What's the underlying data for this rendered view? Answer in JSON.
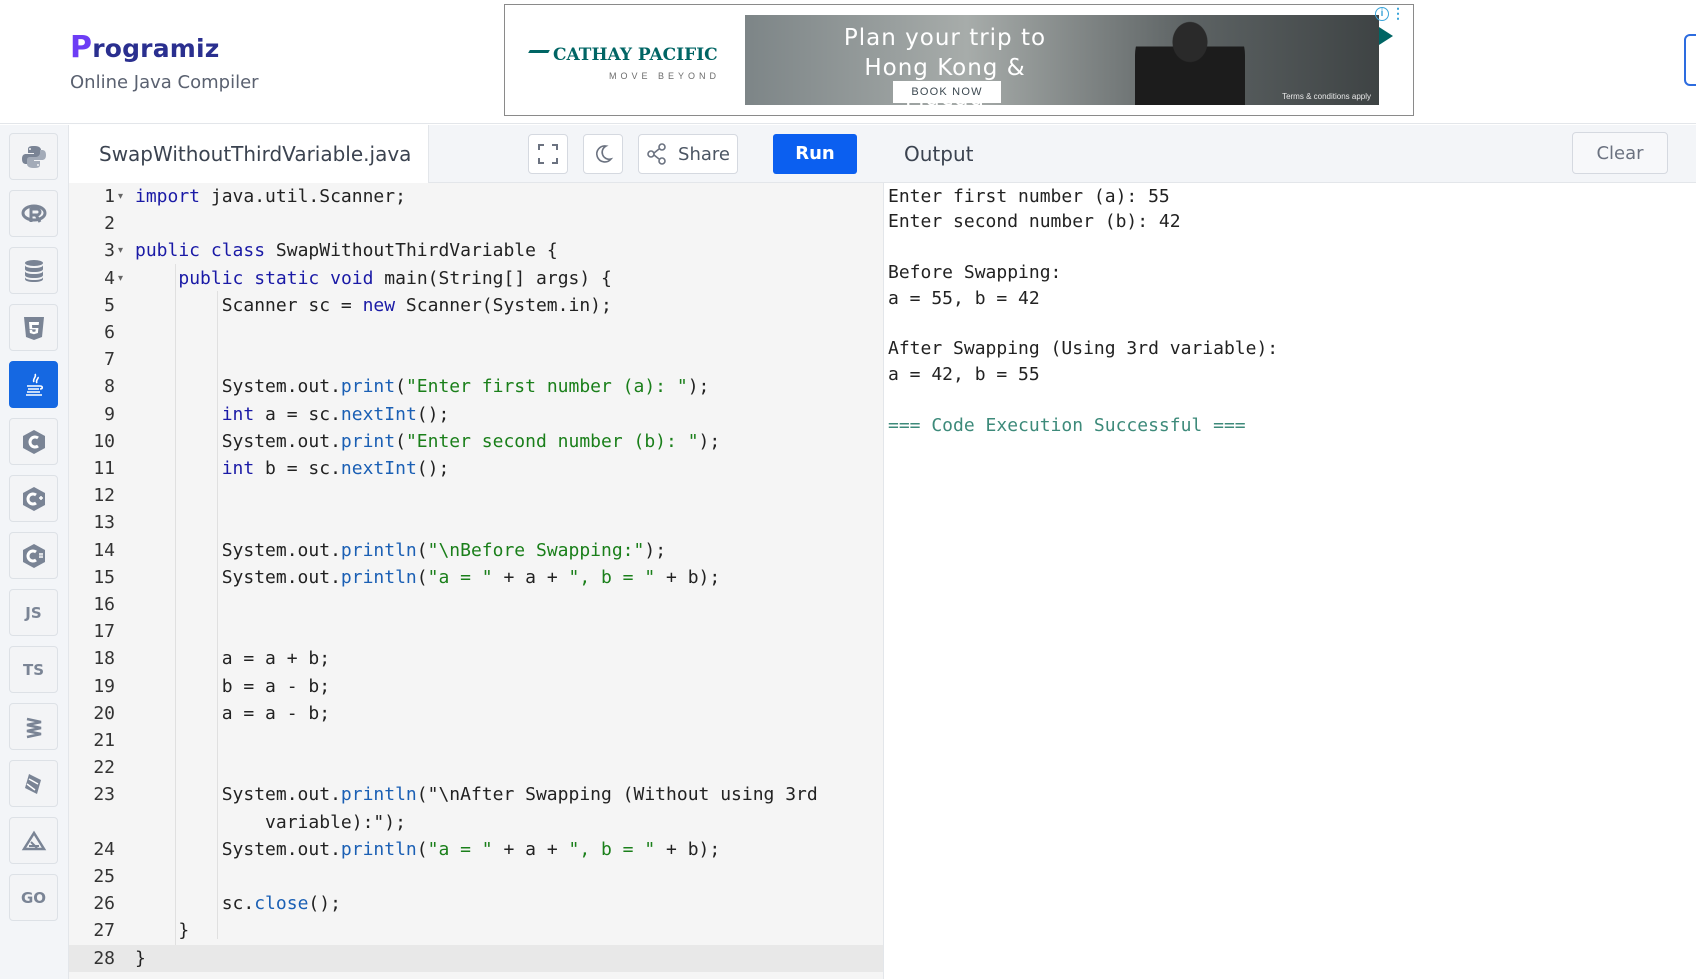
{
  "brand": {
    "logo_initial": "P",
    "logo_rest": "rogramiz",
    "subtitle": "Online Java Compiler"
  },
  "ad": {
    "brand": "CATHAY PACIFIC",
    "tagline": "MOVE BEYOND",
    "headline": "Plan your trip to Hong Kong & Macau",
    "cta": "BOOK NOW",
    "terms": "Terms & conditions apply",
    "info_icon": "info-icon",
    "colors": {
      "brand": "#006564",
      "info": "#3ba4d9"
    }
  },
  "sidebar": {
    "items": [
      {
        "name": "python",
        "icon": "python-icon",
        "label": ""
      },
      {
        "name": "r",
        "icon": "r-icon",
        "label": ""
      },
      {
        "name": "sql",
        "icon": "database-icon",
        "label": ""
      },
      {
        "name": "html",
        "icon": "html5-icon",
        "label": ""
      },
      {
        "name": "java",
        "icon": "java-icon",
        "label": "",
        "active": true
      },
      {
        "name": "c",
        "icon": "c-icon",
        "label": ""
      },
      {
        "name": "cpp",
        "icon": "cpp-icon",
        "label": ""
      },
      {
        "name": "csharp",
        "icon": "csharp-icon",
        "label": ""
      },
      {
        "name": "javascript",
        "icon": "js-icon",
        "label": "JS"
      },
      {
        "name": "typescript",
        "icon": "ts-icon",
        "label": "TS"
      },
      {
        "name": "swift",
        "icon": "swift-icon",
        "label": ""
      },
      {
        "name": "kotlin",
        "icon": "kotlin-icon",
        "label": ""
      },
      {
        "name": "rust",
        "icon": "rust-icon",
        "label": ""
      },
      {
        "name": "go",
        "icon": "go-icon",
        "label": "GO"
      }
    ],
    "active_color": "#1568e2"
  },
  "editor": {
    "filename": "SwapWithoutThirdVariable.java",
    "share_label": "Share",
    "run_label": "Run",
    "run_color": "#0b5ff0",
    "lines": [
      {
        "n": "1",
        "code": "import java.util.Scanner;"
      },
      {
        "n": "2",
        "code": ""
      },
      {
        "n": "3",
        "code": "public class SwapWithoutThirdVariable {"
      },
      {
        "n": "4",
        "code": "    public static void main(String[] args) {"
      },
      {
        "n": "5",
        "code": "        Scanner sc = new Scanner(System.in);"
      },
      {
        "n": "6",
        "code": ""
      },
      {
        "n": "7",
        "code": ""
      },
      {
        "n": "8",
        "code": "        System.out.print(\"Enter first number (a): \");"
      },
      {
        "n": "9",
        "code": "        int a = sc.nextInt();"
      },
      {
        "n": "10",
        "code": "        System.out.print(\"Enter second number (b): \");"
      },
      {
        "n": "11",
        "code": "        int b = sc.nextInt();"
      },
      {
        "n": "12",
        "code": ""
      },
      {
        "n": "13",
        "code": ""
      },
      {
        "n": "14",
        "code": "        System.out.println(\"\\nBefore Swapping:\");"
      },
      {
        "n": "15",
        "code": "        System.out.println(\"a = \" + a + \", b = \" + b);"
      },
      {
        "n": "16",
        "code": ""
      },
      {
        "n": "17",
        "code": ""
      },
      {
        "n": "18",
        "code": "        a = a + b;"
      },
      {
        "n": "19",
        "code": "        b = a - b;"
      },
      {
        "n": "20",
        "code": "        a = a - b;"
      },
      {
        "n": "21",
        "code": ""
      },
      {
        "n": "22",
        "code": ""
      },
      {
        "n": "23",
        "code": "        System.out.println(\"\\nAfter Swapping (Without using 3rd"
      },
      {
        "n": "",
        "code": "            variable):\");"
      },
      {
        "n": "24",
        "code": "        System.out.println(\"a = \" + a + \", b = \" + b);"
      },
      {
        "n": "25",
        "code": ""
      },
      {
        "n": "26",
        "code": "        sc.close();"
      },
      {
        "n": "27",
        "code": "    }"
      },
      {
        "n": "28",
        "code": "}"
      }
    ]
  },
  "output": {
    "title": "Output",
    "clear_label": "Clear",
    "lines": [
      "Enter first number (a): 55",
      "Enter second number (b): 42",
      "",
      "Before Swapping:",
      "a = 55, b = 42",
      "",
      "After Swapping (Using 3rd variable):",
      "a = 42, b = 55",
      "",
      "=== Code Execution Successful ==="
    ]
  }
}
